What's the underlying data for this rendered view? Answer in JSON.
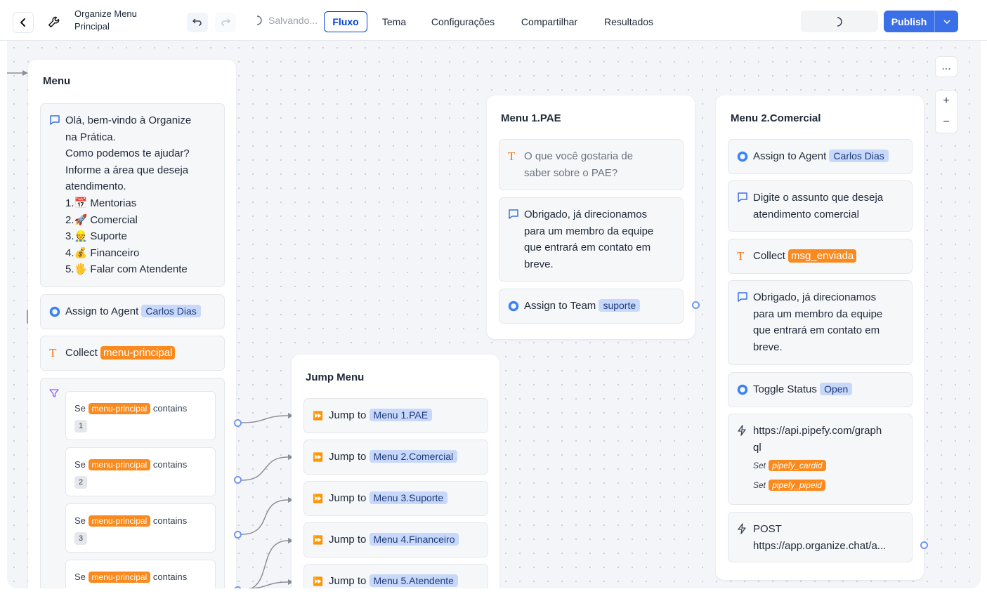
{
  "header": {
    "title": "Organize Menu Principal",
    "saving": "Salvando...",
    "tabs": [
      "Fluxo",
      "Tema",
      "Configurações",
      "Compartilhar",
      "Resultados"
    ],
    "active_tab": "Fluxo",
    "publish_label": "Publish"
  },
  "canvas_tools": {
    "more": "...",
    "zoom_in": "+",
    "zoom_out": "−"
  },
  "groups": {
    "menu": {
      "title": "Menu",
      "message": [
        "Olá, bem-vindo à Organize",
        "na Prática.",
        "Como podemos te ajudar?",
        "Informe a área que deseja",
        "atendimento.",
        "1.📅 Mentorias",
        "2.🚀 Comercial",
        "3.👷 Suporte",
        "4.💰 Financeiro",
        "5.🖐 Falar com Atendente"
      ],
      "assign_label": "Assign to Agent",
      "assign_agent": "Carlos Dias",
      "collect_label": "Collect",
      "collect_var": "menu-principal",
      "conditions": [
        {
          "se": "Se",
          "var": "menu-principal",
          "op": "contains",
          "value": "1"
        },
        {
          "se": "Se",
          "var": "menu-principal",
          "op": "contains",
          "value": "2"
        },
        {
          "se": "Se",
          "var": "menu-principal",
          "op": "contains",
          "value": "3"
        },
        {
          "se": "Se",
          "var": "menu-principal",
          "op": "contains",
          "value": ""
        }
      ]
    },
    "jump_menu": {
      "title": "Jump Menu",
      "jump_label": "Jump to",
      "targets": [
        "Menu 1.PAE",
        "Menu 2.Comercial",
        "Menu 3.Suporte",
        "Menu 4.Financeiro",
        "Menu 5.Atendente"
      ]
    },
    "menu_pae": {
      "title": "Menu 1.PAE",
      "input_lines": [
        "O que você gostaria de",
        "saber sobre o PAE?"
      ],
      "message_lines": [
        "Obrigado, já direcionamos",
        "para um membro da equipe",
        "que entrará em contato em",
        "breve."
      ],
      "assign_label": "Assign to Team",
      "assign_team": "suporte"
    },
    "menu_comercial": {
      "title": "Menu 2.Comercial",
      "assign_label": "Assign to Agent",
      "assign_agent": "Carlos Dias",
      "message1_lines": [
        "Digite o assunto que deseja",
        "atendimento comercial"
      ],
      "collect_label": "Collect",
      "collect_var": "msg_enviada",
      "message2_lines": [
        "Obrigado, já direcionamos",
        "para um membro da equipe",
        "que entrará em contato em",
        "breve."
      ],
      "toggle_label": "Toggle Status",
      "toggle_value": "Open",
      "webhook_lines": [
        "https://api.pipefy.com/graph",
        "ql"
      ],
      "set_label": "Set",
      "set_vars": [
        "pipefy_cardid",
        "pipefy_pipeid"
      ],
      "post_lines": [
        "POST",
        "https://app.organize.chat/a..."
      ]
    }
  },
  "colors": {
    "accent": "#0042da",
    "publish": "#3b6fe8",
    "tag_orange": "#fb8a1e",
    "tag_blue": "#c7d8fb",
    "port": "#6e97f0"
  }
}
